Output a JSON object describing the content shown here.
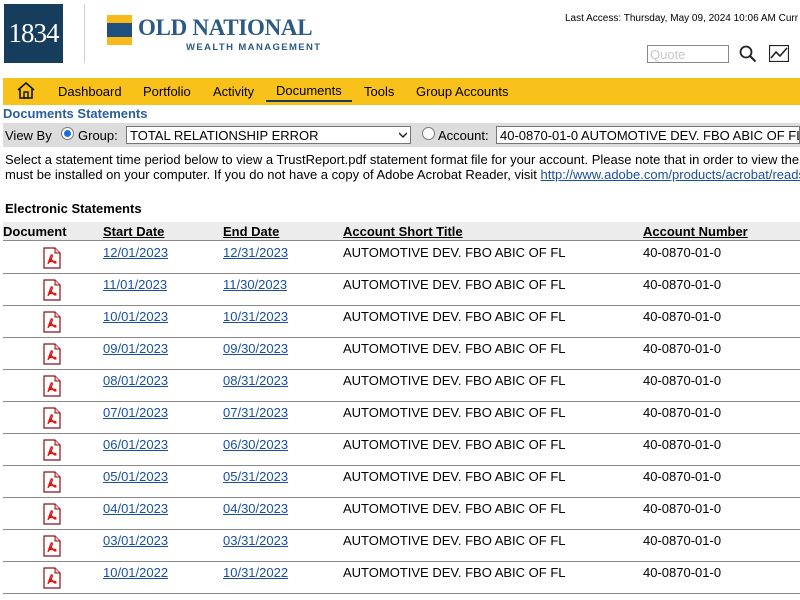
{
  "header": {
    "logo_text": "1834",
    "brand_name": "OLD NATIONAL",
    "brand_sub": "WEALTH MANAGEMENT",
    "last_access": "Last Access: Thursday, May 09, 2024 10:06 AM Curr",
    "quote_placeholder": "Quote",
    "icons": {
      "search": "search-icon",
      "chart": "chart-icon",
      "home": "home-icon"
    }
  },
  "nav": {
    "items": [
      {
        "label": "Dashboard"
      },
      {
        "label": "Portfolio"
      },
      {
        "label": "Activity"
      },
      {
        "label": "Documents",
        "active": true
      },
      {
        "label": "Tools"
      },
      {
        "label": "Group Accounts"
      }
    ]
  },
  "section_title": "Documents Statements",
  "view_by": {
    "label": "View By",
    "group_label": "Group:",
    "group_value": "TOTAL RELATIONSHIP ERROR",
    "account_label": "Account:",
    "account_value": "40-0870-01-0 AUTOMOTIVE DEV. FBO ABIC OF FL"
  },
  "intro": {
    "line1": "Select a statement time period below to view a TrustReport.pdf statement format file for your account. Please note that in order to view the",
    "line2": "must be installed on your computer. If you do not have a copy of Adobe Acrobat Reader, visit",
    "link": "http://www.adobe.com/products/acrobat/readst"
  },
  "statements": {
    "heading": "Electronic Statements",
    "columns": [
      "Document",
      "Start Date",
      "End Date",
      "Account Short Title",
      "Account Number"
    ],
    "rows": [
      {
        "start": "12/01/2023",
        "end": "12/31/2023",
        "title": "AUTOMOTIVE DEV. FBO ABIC OF FL",
        "number": "40-0870-01-0"
      },
      {
        "start": "11/01/2023",
        "end": "11/30/2023",
        "title": "AUTOMOTIVE DEV. FBO ABIC OF FL",
        "number": "40-0870-01-0"
      },
      {
        "start": "10/01/2023",
        "end": "10/31/2023",
        "title": "AUTOMOTIVE DEV. FBO ABIC OF FL",
        "number": "40-0870-01-0"
      },
      {
        "start": "09/01/2023",
        "end": "09/30/2023",
        "title": "AUTOMOTIVE DEV. FBO ABIC OF FL",
        "number": "40-0870-01-0"
      },
      {
        "start": "08/01/2023",
        "end": "08/31/2023",
        "title": "AUTOMOTIVE DEV. FBO ABIC OF FL",
        "number": "40-0870-01-0"
      },
      {
        "start": "07/01/2023",
        "end": "07/31/2023",
        "title": "AUTOMOTIVE DEV. FBO ABIC OF FL",
        "number": "40-0870-01-0"
      },
      {
        "start": "06/01/2023",
        "end": "06/30/2023",
        "title": "AUTOMOTIVE DEV. FBO ABIC OF FL",
        "number": "40-0870-01-0"
      },
      {
        "start": "05/01/2023",
        "end": "05/31/2023",
        "title": "AUTOMOTIVE DEV. FBO ABIC OF FL",
        "number": "40-0870-01-0"
      },
      {
        "start": "04/01/2023",
        "end": "04/30/2023",
        "title": "AUTOMOTIVE DEV. FBO ABIC OF FL",
        "number": "40-0870-01-0"
      },
      {
        "start": "03/01/2023",
        "end": "03/31/2023",
        "title": "AUTOMOTIVE DEV. FBO ABIC OF FL",
        "number": "40-0870-01-0"
      },
      {
        "start": "10/01/2022",
        "end": "10/31/2022",
        "title": "AUTOMOTIVE DEV. FBO ABIC OF FL",
        "number": "40-0870-01-0"
      }
    ]
  }
}
